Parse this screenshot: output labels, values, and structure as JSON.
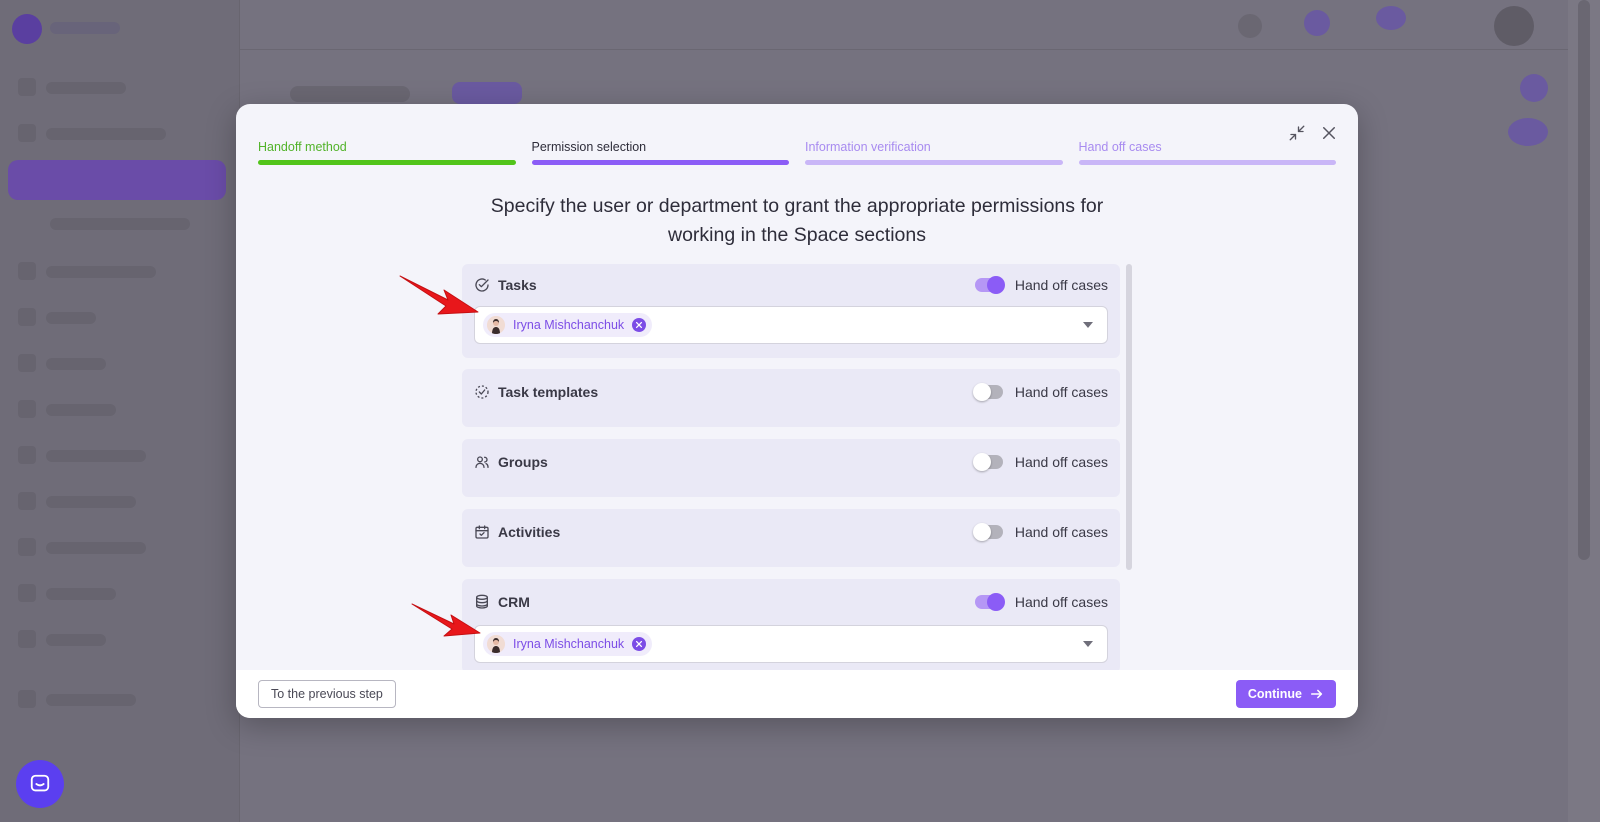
{
  "steps": [
    {
      "label": "Handoff method",
      "state": "done"
    },
    {
      "label": "Permission selection",
      "state": "current"
    },
    {
      "label": "Information verification",
      "state": "todo"
    },
    {
      "label": "Hand off cases",
      "state": "todo"
    }
  ],
  "heading_line1": "Specify the user or department to grant the appropriate permissions for",
  "heading_line2": "working in the Space sections",
  "toggle_label": "Hand off cases",
  "sections": [
    {
      "title": "Tasks",
      "icon": "check-circle-icon",
      "enabled": true,
      "assignee": "Iryna Mishchanchuk"
    },
    {
      "title": "Task templates",
      "icon": "dashed-check-circle-icon",
      "enabled": false
    },
    {
      "title": "Groups",
      "icon": "users-icon",
      "enabled": false
    },
    {
      "title": "Activities",
      "icon": "calendar-check-icon",
      "enabled": false
    },
    {
      "title": "CRM",
      "icon": "database-icon",
      "enabled": true,
      "assignee": "Iryna Mishchanchuk"
    }
  ],
  "footer": {
    "prev_label": "To the previous step",
    "continue_label": "Continue"
  },
  "colors": {
    "accent": "#8b5cf6",
    "done": "#52c41a",
    "annotation_arrow": "#e8171b"
  }
}
